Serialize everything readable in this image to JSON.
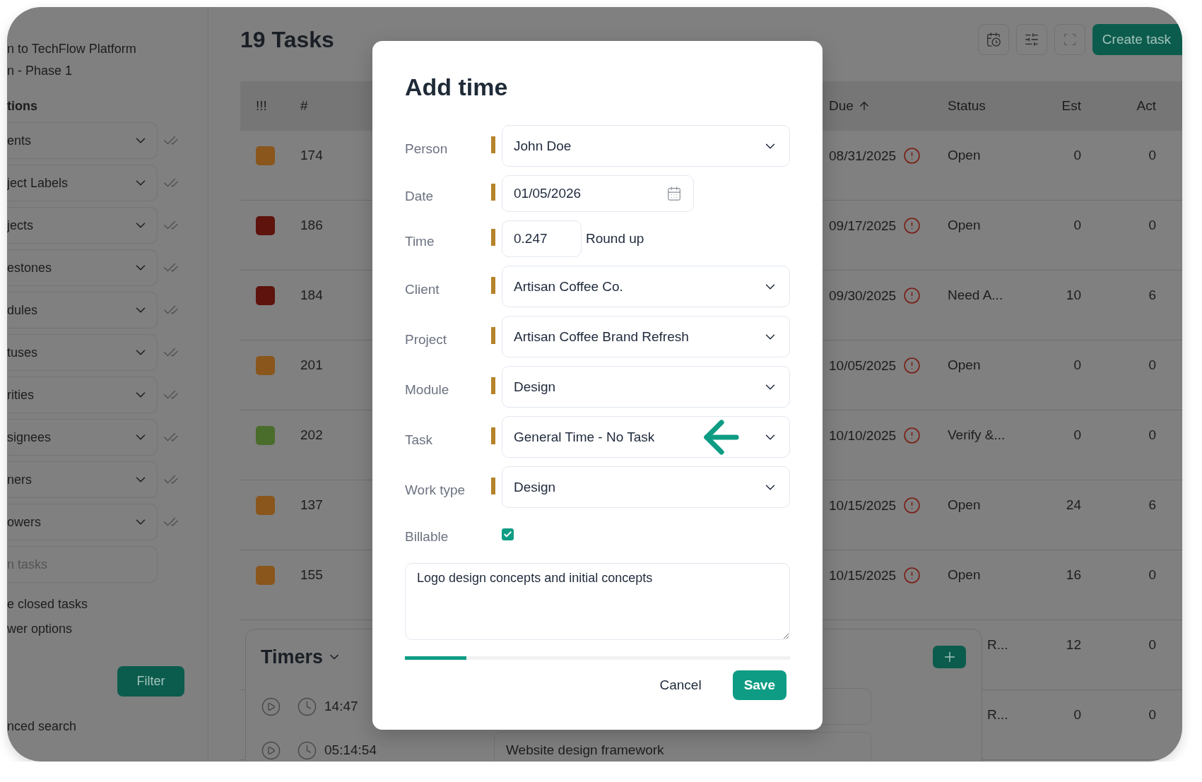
{
  "sidebar": {
    "links": [
      "n to TechFlow Platform",
      "n - Phase 1"
    ],
    "section_title": "tions",
    "filters": [
      {
        "label": "ents"
      },
      {
        "label": "ject Labels"
      },
      {
        "label": "jects"
      },
      {
        "label": "estones"
      },
      {
        "label": "dules"
      },
      {
        "label": "tuses"
      },
      {
        "label": "rities"
      },
      {
        "label": "signees"
      },
      {
        "label": "ners"
      },
      {
        "label": "owers"
      }
    ],
    "search": {
      "placeholder": "n tasks"
    },
    "options": [
      "e closed tasks",
      "wer options"
    ],
    "filter_button": "Filter",
    "advanced_link": "nced search"
  },
  "main": {
    "title": "19 Tasks",
    "create_button": "Create task"
  },
  "table": {
    "columns": [
      {
        "label": "!!!"
      },
      {
        "label": "#"
      },
      {
        "label": "Due",
        "sorted": true
      },
      {
        "label": "Status"
      },
      {
        "label": "Est"
      },
      {
        "label": "Act"
      }
    ],
    "rows": [
      {
        "color": "#8a561c",
        "number": "174",
        "due": "08/31/2025",
        "overdue": true,
        "status": "Open",
        "est": "0",
        "act": "0"
      },
      {
        "color": "#5e130d",
        "number": "186",
        "due": "09/17/2025",
        "overdue": true,
        "status": "Open",
        "est": "0",
        "act": "0"
      },
      {
        "color": "#5e130d",
        "number": "184",
        "due": "09/30/2025",
        "overdue": true,
        "status": "Need A...",
        "est": "10",
        "act": "6"
      },
      {
        "color": "#8a561c",
        "number": "201",
        "due": "10/05/2025",
        "overdue": true,
        "status": "Open",
        "est": "0",
        "act": "0"
      },
      {
        "color": "#4a6d2b",
        "number": "202",
        "due": "10/10/2025",
        "overdue": true,
        "status": "Verify &...",
        "est": "0",
        "act": "0"
      },
      {
        "color": "#8a561c",
        "number": "137",
        "due": "10/15/2025",
        "overdue": true,
        "status": "Open",
        "est": "24",
        "act": "6"
      },
      {
        "color": "#8a561c",
        "number": "155",
        "due": "10/15/2025",
        "overdue": true,
        "status": "Open",
        "est": "16",
        "act": "0"
      }
    ],
    "partial_rows": [
      {
        "status": "R...",
        "est": "12",
        "act": "0"
      },
      {
        "status": "R...",
        "est": "0",
        "act": "0"
      }
    ]
  },
  "timers": {
    "title": "Timers",
    "rows": [
      {
        "time": "14:47"
      },
      {
        "time": "05:14:54",
        "description": "Website design framework"
      }
    ]
  },
  "dialog": {
    "title": "Add time",
    "fields": [
      {
        "kind": "select",
        "label": "Person",
        "value": "John Doe",
        "required": true
      },
      {
        "kind": "date",
        "label": "Date",
        "value": "01/05/2026",
        "required": true
      },
      {
        "kind": "number",
        "label": "Time",
        "value": "0.247",
        "suffix": "Round up",
        "required": true
      },
      {
        "kind": "select",
        "label": "Client",
        "value": "Artisan Coffee Co.",
        "required": true
      },
      {
        "kind": "select",
        "label": "Project",
        "value": "Artisan Coffee Brand Refresh",
        "required": true
      },
      {
        "kind": "select",
        "label": "Module",
        "value": "Design",
        "required": true
      },
      {
        "kind": "select",
        "label": "Task",
        "value": "General Time - No Task",
        "required": true,
        "annotated": true
      },
      {
        "kind": "select",
        "label": "Work type",
        "value": "Design",
        "required": true
      },
      {
        "kind": "checkbox",
        "label": "Billable",
        "checked": true
      }
    ],
    "notes": "Logo design concepts and initial concepts",
    "progress": {
      "level": 0.16
    },
    "buttons": [
      {
        "label": "Cancel",
        "kind": "secondary"
      },
      {
        "label": "Save",
        "kind": "primary"
      }
    ]
  }
}
